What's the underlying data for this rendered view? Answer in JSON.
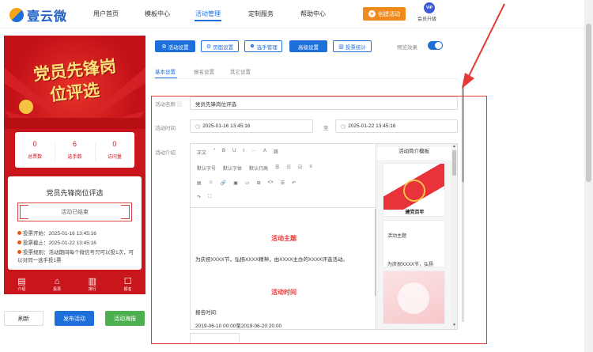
{
  "brand": {
    "name": "壹云微"
  },
  "nav": {
    "items": [
      "用户首页",
      "模板中心",
      "活动管理",
      "定制服务",
      "帮助中心"
    ],
    "active_index": 2,
    "create_button": "创建活动",
    "vip_badge": "VIP",
    "vip_label": "会员升级"
  },
  "preview": {
    "title_line1": "党员先锋岗",
    "title_line2": "位评选",
    "stats": [
      {
        "value": "0",
        "label": "总票数"
      },
      {
        "value": "6",
        "label": "选手数"
      },
      {
        "value": "0",
        "label": "访问量"
      }
    ],
    "activity_title": "党员先锋岗位评选",
    "status": "活动已结束",
    "rules": [
      "投票开始：2025-01-16 13:45:16",
      "投票截止：2025-01-22 13:45:16",
      "投票规则：活动期间每个微信号只可以投1次，可以对同一选手投1票"
    ],
    "tabbar": [
      {
        "icon": "doc-icon",
        "label": "介绍"
      },
      {
        "icon": "home-icon",
        "label": "投票"
      },
      {
        "icon": "ranking-icon",
        "label": "排行"
      },
      {
        "icon": "signup-icon",
        "label": "报名"
      }
    ]
  },
  "actions": {
    "refresh": "刷新",
    "publish": "发布活动",
    "poster": "活动海报"
  },
  "toolbar": {
    "buttons": [
      "活动设置",
      "页面设置",
      "选手管理",
      "高级设置",
      "投票统计"
    ],
    "preview_toggle_label": "预览效果",
    "preview_toggle_on": true
  },
  "subtabs": {
    "items": [
      "基本设置",
      "报名设置",
      "其它设置"
    ],
    "active_index": 0
  },
  "form": {
    "name_label": "活动名称",
    "name_value": "党员先锋岗位评选",
    "time_label": "活动时间",
    "start_time": "2025-01-16 13:45:16",
    "separator": "至",
    "end_time": "2025-01-22 13:45:16",
    "intro_label": "活动介绍"
  },
  "editor": {
    "toolbar_row1": [
      "正文",
      "“",
      "B",
      "U",
      "I",
      "···",
      "A",
      "▨"
    ],
    "toolbar_row2": [
      "默认字号",
      "默认字体",
      "默认行高",
      "☰",
      "☷",
      "☑",
      "≡"
    ],
    "toolbar_row3": [
      "▤",
      "☺",
      "🔗",
      "▣",
      "▭",
      "⊞",
      "<>",
      "☰",
      "↶"
    ],
    "toolbar_row4": [
      "↷",
      "⛶"
    ],
    "heading1": "活动主题",
    "paragraph1": "为庆祝XXXX节，弘扬XXXX精神，由XXXX主办的XXXX评选活动。",
    "heading2": "活动时间",
    "paragraph2": "报名时间:",
    "paragraph3": "2019-06-10 00:00至2019-06-20 20:00"
  },
  "templates": {
    "title": "活动简介模板",
    "card1_caption": "建党百年",
    "card2_title": "活动主题",
    "card2_text": "为庆祝XXXX节，弘扬"
  }
}
